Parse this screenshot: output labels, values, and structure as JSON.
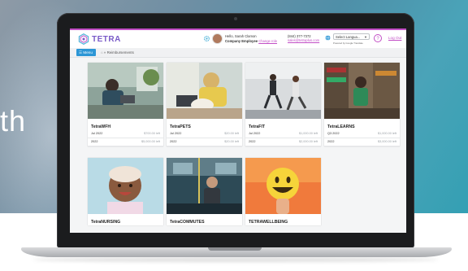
{
  "background": {
    "word": "th"
  },
  "header": {
    "logo_text": "TETRA",
    "greeting": "Hello, Sarah Clamon",
    "role": "Company Employee",
    "change_role": "Change role",
    "phone": "(844) 377-7372",
    "email": "sales@tetraplus.com",
    "language_placeholder": "Select Langua...",
    "powered_by": "Powered by Google Translate",
    "help": "?",
    "logout": "Log Out",
    "accent_color": "#c24fc6"
  },
  "subbar": {
    "menu_label": "Menu",
    "breadcrumb_sep": "»",
    "breadcrumb_current": "Reimbursements"
  },
  "cards": [
    {
      "title": "TetraWFH",
      "rows": [
        {
          "period": "Jul 2022",
          "amount": "$700.00 left"
        },
        {
          "period": "2022",
          "amount": "$5,000.00 left"
        }
      ]
    },
    {
      "title": "TetraPETS",
      "rows": [
        {
          "period": "Jul 2022",
          "amount": "$20.00 left"
        },
        {
          "period": "2022",
          "amount": "$20.00 left"
        }
      ]
    },
    {
      "title": "TetraFIT",
      "rows": [
        {
          "period": "Jul 2022",
          "amount": "$1,000.00 left"
        },
        {
          "period": "2022",
          "amount": "$2,000.00 left"
        }
      ]
    },
    {
      "title": "TetraLEARNS",
      "rows": [
        {
          "period": "Q3 2022",
          "amount": "$1,000.00 left"
        },
        {
          "period": "2022",
          "amount": "$3,000.00 left"
        }
      ]
    },
    {
      "title": "TetraNURSING",
      "rows": []
    },
    {
      "title": "TetraCOMMUTES",
      "rows": []
    },
    {
      "title": "TETRAWELLBEING",
      "rows": []
    }
  ]
}
